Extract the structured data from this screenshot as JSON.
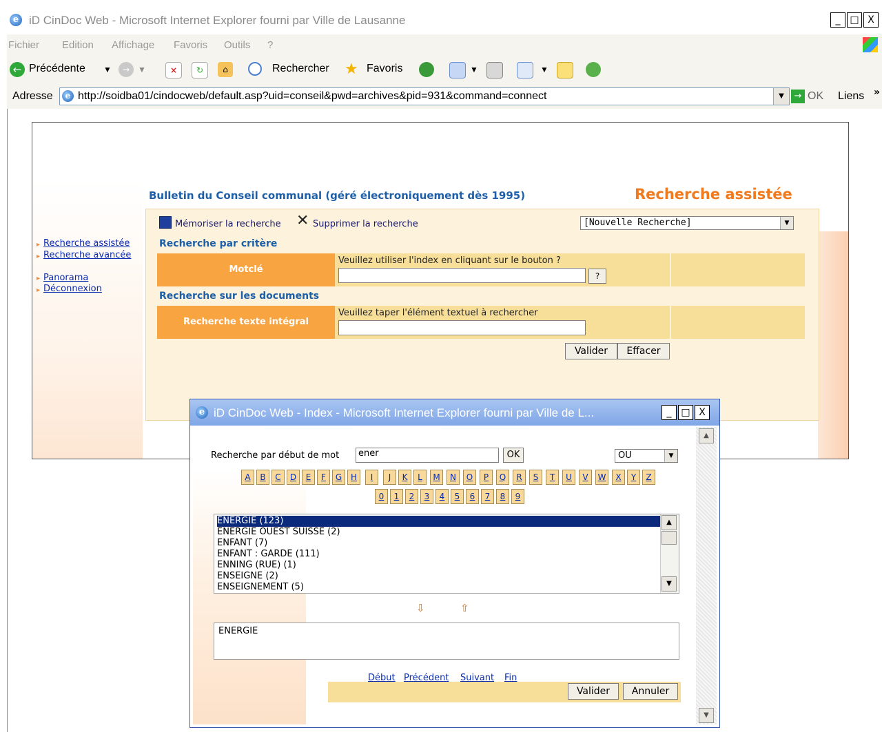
{
  "browser": {
    "title": "iD CinDoc Web - Microsoft Internet Explorer fourni par Ville de Lausanne",
    "menu": [
      "Fichier",
      "Edition",
      "Affichage",
      "Favoris",
      "Outils",
      "?"
    ],
    "toolbar": {
      "back": "Précédente",
      "search": "Rechercher",
      "favorites": "Favoris"
    },
    "address_label": "Adresse",
    "url": "http://soidba01/cindocweb/default.asp?uid=conseil&pwd=archives&pid=931&command=connect",
    "go_label": "OK",
    "links_label": "Liens",
    "links_chevron": "»",
    "icons": [
      "ie-logo-icon",
      "back-arrow-icon",
      "forward-arrow-icon",
      "stop-icon",
      "refresh-icon",
      "home-icon",
      "search-icon",
      "favorites-star-icon",
      "history-icon",
      "mail-icon",
      "print-icon",
      "edit-icon",
      "folder-icon",
      "messenger-icon",
      "go-arrow-icon",
      "windows-flag-icon"
    ],
    "window_buttons": {
      "minimize": "_",
      "maximize": "□",
      "close": "X"
    }
  },
  "page": {
    "site_title": "Bulletin du Conseil communal (géré électroniquement dès 1995)",
    "heading": "Recherche assistée",
    "nav": [
      "Recherche assistée",
      "Recherche avancée",
      "Panorama",
      "Déconnexion"
    ],
    "actions": {
      "save": "Mémoriser la recherche",
      "delete": "Supprimer la recherche"
    },
    "saved_search_select": "[Nouvelle Recherche]",
    "section_criteria": "Recherche par critère",
    "keyword_label": "Motclé",
    "keyword_hint": "Veuillez utiliser l'index en cliquant sur le bouton ?",
    "keyword_value": "",
    "index_button": "?",
    "section_documents": "Recherche sur les documents",
    "fulltext_label": "Recherche texte intégral",
    "fulltext_hint": "Veuillez taper l'élément textuel à rechercher",
    "fulltext_value": "",
    "validate": "Valider",
    "clear": "Effacer"
  },
  "popup": {
    "title": "iD CinDoc Web - Index - Microsoft Internet Explorer fourni par Ville de L...",
    "search_label": "Recherche par début de mot",
    "search_value": "ener",
    "ok": "OK",
    "operator": "OU",
    "letters": [
      "A",
      "B",
      "C",
      "D",
      "E",
      "F",
      "G",
      "H",
      "I",
      "J",
      "K",
      "L",
      "M",
      "N",
      "O",
      "P",
      "Q",
      "R",
      "S",
      "T",
      "U",
      "V",
      "W",
      "X",
      "Y",
      "Z"
    ],
    "digits": [
      "0",
      "1",
      "2",
      "3",
      "4",
      "5",
      "6",
      "7",
      "8",
      "9"
    ],
    "results": [
      "ENERGIE (123)",
      "ENERGIE OUEST SUISSE (2)",
      "ENFANT (7)",
      "ENFANT : GARDE (111)",
      "ENNING (RUE) (1)",
      "ENSEIGNE (2)",
      "ENSEIGNEMENT (5)"
    ],
    "selected_index": 0,
    "selected_terms": "ENERGIE",
    "move_down": "⇩",
    "move_up": "⇧",
    "pager": [
      "Début",
      "Précédent",
      "Suivant",
      "Fin"
    ],
    "validate": "Valider",
    "cancel": "Annuler"
  }
}
